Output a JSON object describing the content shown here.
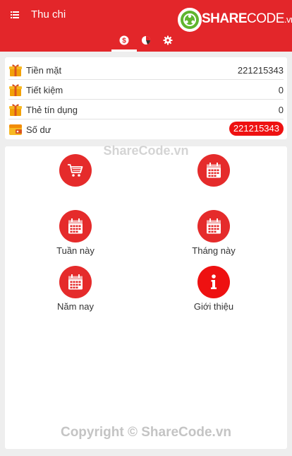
{
  "appbar": {
    "title": "Thu chi",
    "logo": {
      "brand": "SHARE",
      "code": "CODE",
      "tld": ".vn"
    },
    "tabs": [
      {
        "icon": "dollar-icon"
      },
      {
        "icon": "pie-chart-icon"
      },
      {
        "icon": "gear-icon"
      }
    ]
  },
  "summary": {
    "rows": [
      {
        "label": "Tiền mặt",
        "value": "221215343",
        "icon": "gift-icon"
      },
      {
        "label": "Tiết kiệm",
        "value": "0",
        "icon": "gift-icon"
      },
      {
        "label": "Thẻ tín dụng",
        "value": "0",
        "icon": "gift-icon"
      },
      {
        "label": "Số dư",
        "value": "221215343",
        "icon": "wallet-icon"
      }
    ]
  },
  "menu": {
    "items": [
      {
        "label": "",
        "icon": "shopping-cart-icon"
      },
      {
        "label": "",
        "icon": "calendar-icon"
      },
      {
        "label": "Tuần này",
        "icon": "calendar-icon"
      },
      {
        "label": "Tháng này",
        "icon": "calendar-icon"
      },
      {
        "label": "Năm nay",
        "icon": "calendar-icon"
      },
      {
        "label": "Giới thiệu",
        "icon": "info-icon"
      }
    ]
  },
  "watermark": "ShareCode.vn",
  "copyright": "Copyright © ShareCode.vn",
  "colors": {
    "primary": "#e3262a",
    "accent": "#ee1111"
  }
}
